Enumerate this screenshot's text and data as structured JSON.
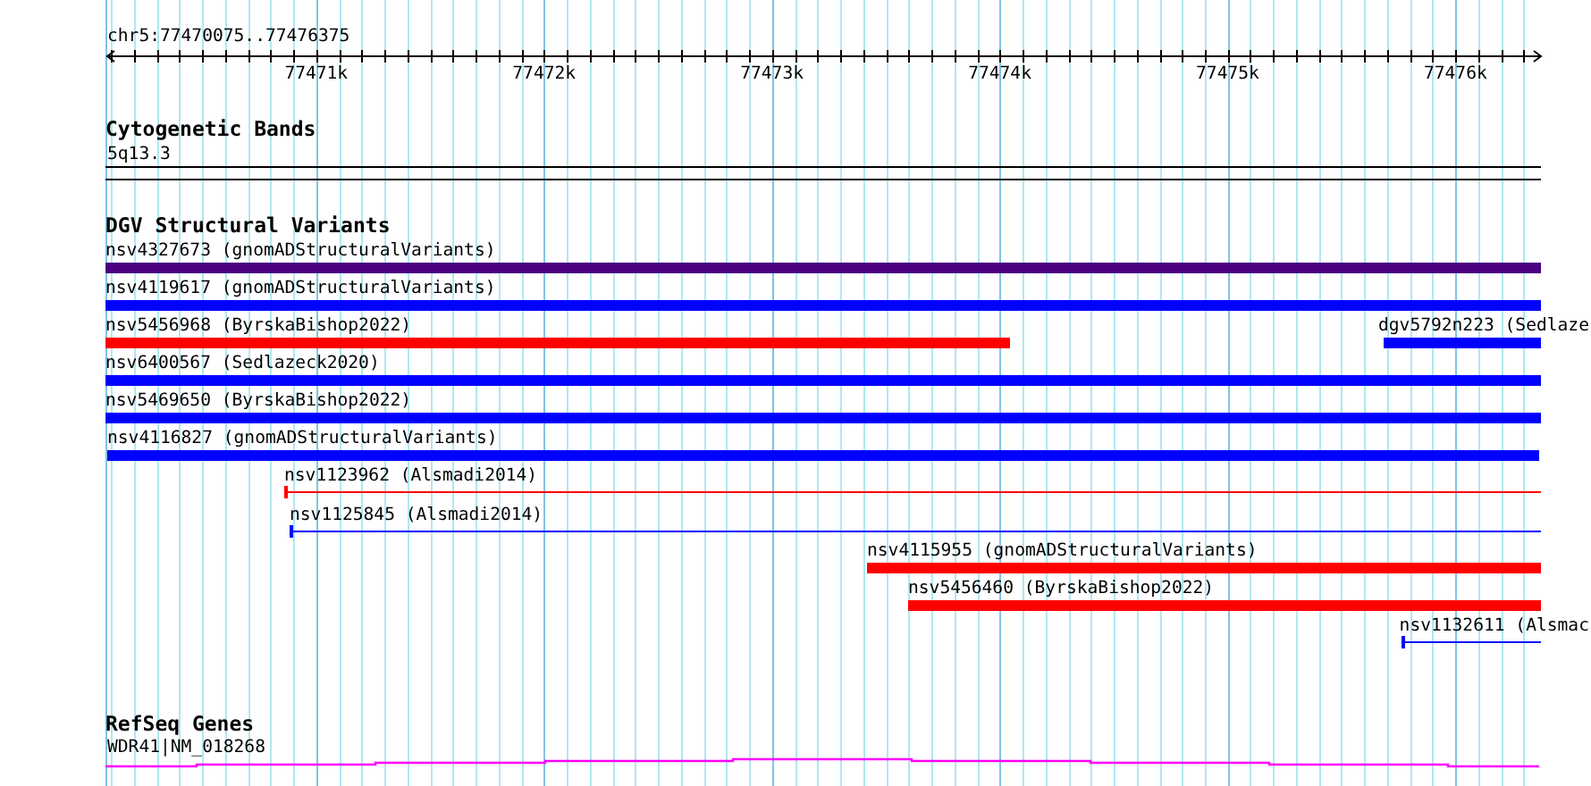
{
  "locus": "chr5:77470075..77476375",
  "ruler": {
    "ticks": [
      "77471k",
      "77472k",
      "77473k",
      "77474k",
      "77475k",
      "77476k"
    ]
  },
  "tracks": [
    {
      "kind": "bands",
      "title": "Cytogenetic Bands",
      "label": "5q13.3"
    },
    {
      "kind": "variants",
      "title": "DGV Structural Variants",
      "features": [
        {
          "label": "nsv4327673 (gnomADStructuralVariants)",
          "color": "#4b0082",
          "kind": "bar"
        },
        {
          "label": "nsv4119617 (gnomADStructuralVariants)",
          "color": "#0000ff",
          "kind": "bar"
        },
        {
          "label": "nsv5456968 (ByrskaBishop2022)",
          "color": "#ff0000",
          "kind": "bar"
        },
        {
          "label": "dgv5792n223 (Sedlaze",
          "color": "#0000ff",
          "kind": "bar"
        },
        {
          "label": "nsv6400567 (Sedlazeck2020)",
          "color": "#0000ff",
          "kind": "bar"
        },
        {
          "label": "nsv5469650 (ByrskaBishop2022)",
          "color": "#0000ff",
          "kind": "bar"
        },
        {
          "label": "nsv4116827 (gnomADStructuralVariants)",
          "color": "#0000ff",
          "kind": "bar"
        },
        {
          "label": "nsv1123962 (Alsmadi2014)",
          "color": "#ff0000",
          "kind": "line"
        },
        {
          "label": "nsv1125845 (Alsmadi2014)",
          "color": "#0000ff",
          "kind": "line"
        },
        {
          "label": "nsv4115955 (gnomADStructuralVariants)",
          "color": "#ff0000",
          "kind": "bar"
        },
        {
          "label": "nsv5456460 (ByrskaBishop2022)",
          "color": "#ff0000",
          "kind": "bar"
        },
        {
          "label": "nsv1132611 (Alsmac",
          "color": "#0000ff",
          "kind": "line"
        }
      ]
    },
    {
      "kind": "genes",
      "title": "RefSeq Genes",
      "label": "WDR41|NM_018268"
    }
  ]
}
